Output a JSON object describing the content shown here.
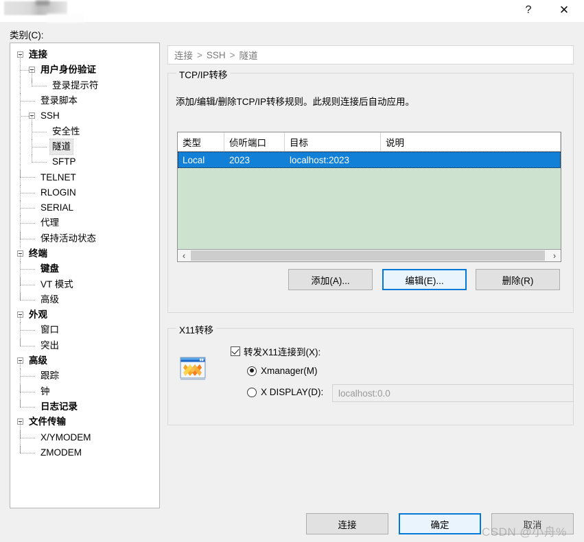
{
  "window": {
    "title_redacted": "",
    "help_icon": "question-mark-icon",
    "close_icon": "close-icon"
  },
  "category": {
    "label": "类别(C):",
    "tree": [
      {
        "label": "连接",
        "level": 0,
        "bold": true,
        "expander": true,
        "selected": false
      },
      {
        "label": "用户身份验证",
        "level": 1,
        "bold": true,
        "expander": true,
        "selected": false
      },
      {
        "label": "登录提示符",
        "level": 2,
        "bold": false,
        "expander": false,
        "selected": false
      },
      {
        "label": "登录脚本",
        "level": 1,
        "bold": false,
        "expander": false,
        "selected": false
      },
      {
        "label": "SSH",
        "level": 1,
        "bold": false,
        "expander": true,
        "selected": false
      },
      {
        "label": "安全性",
        "level": 2,
        "bold": false,
        "expander": false,
        "selected": false
      },
      {
        "label": "隧道",
        "level": 2,
        "bold": false,
        "expander": false,
        "selected": true
      },
      {
        "label": "SFTP",
        "level": 2,
        "bold": false,
        "expander": false,
        "selected": false
      },
      {
        "label": "TELNET",
        "level": 1,
        "bold": false,
        "expander": false,
        "selected": false
      },
      {
        "label": "RLOGIN",
        "level": 1,
        "bold": false,
        "expander": false,
        "selected": false
      },
      {
        "label": "SERIAL",
        "level": 1,
        "bold": false,
        "expander": false,
        "selected": false
      },
      {
        "label": "代理",
        "level": 1,
        "bold": false,
        "expander": false,
        "selected": false
      },
      {
        "label": "保持活动状态",
        "level": 1,
        "bold": false,
        "expander": false,
        "selected": false
      },
      {
        "label": "终端",
        "level": 0,
        "bold": true,
        "expander": true,
        "selected": false
      },
      {
        "label": "键盘",
        "level": 1,
        "bold": true,
        "expander": false,
        "selected": false
      },
      {
        "label": "VT 模式",
        "level": 1,
        "bold": false,
        "expander": false,
        "selected": false
      },
      {
        "label": "高级",
        "level": 1,
        "bold": false,
        "expander": false,
        "selected": false
      },
      {
        "label": "外观",
        "level": 0,
        "bold": true,
        "expander": true,
        "selected": false
      },
      {
        "label": "窗口",
        "level": 1,
        "bold": false,
        "expander": false,
        "selected": false
      },
      {
        "label": "突出",
        "level": 1,
        "bold": false,
        "expander": false,
        "selected": false
      },
      {
        "label": "高级",
        "level": 0,
        "bold": true,
        "expander": true,
        "selected": false
      },
      {
        "label": "跟踪",
        "level": 1,
        "bold": false,
        "expander": false,
        "selected": false
      },
      {
        "label": "钟",
        "level": 1,
        "bold": false,
        "expander": false,
        "selected": false
      },
      {
        "label": "日志记录",
        "level": 1,
        "bold": true,
        "expander": false,
        "selected": false
      },
      {
        "label": "文件传输",
        "level": 0,
        "bold": true,
        "expander": true,
        "selected": false
      },
      {
        "label": "X/YMODEM",
        "level": 1,
        "bold": false,
        "expander": false,
        "selected": false
      },
      {
        "label": "ZMODEM",
        "level": 1,
        "bold": false,
        "expander": false,
        "selected": false
      }
    ]
  },
  "breadcrumb": {
    "part1": "连接",
    "part2": "SSH",
    "part3": "隧道",
    "separator": ">"
  },
  "tcpip": {
    "group_title": "TCP/IP转移",
    "description": "添加/编辑/删除TCP/IP转移规则。此规则连接后自动应用。",
    "columns": [
      "类型",
      "侦听端口",
      "目标",
      "说明"
    ],
    "rows": [
      {
        "type": "Local",
        "port": "2023",
        "target": "localhost:2023",
        "desc": ""
      }
    ],
    "buttons": {
      "add": "添加(A)...",
      "edit": "编辑(E)...",
      "delete": "删除(R)"
    },
    "scroll_left_icon": "chevron-left-icon",
    "scroll_right_icon": "chevron-right-icon"
  },
  "x11": {
    "group_title": "X11转移",
    "icon_name": "xmanager-icon",
    "forward_checkbox_label": "转发X11连接到(X):",
    "forward_checked": true,
    "radio_xmanager_label": "Xmanager(M)",
    "radio_xdisplay_label": "X DISPLAY(D):",
    "selected_radio": "xmanager",
    "display_value": "localhost:0.0"
  },
  "footer": {
    "connect": "连接",
    "ok": "确定",
    "cancel": "取消"
  },
  "watermark": {
    "text": "CSDN @小舟%"
  },
  "colors": {
    "accent": "#0078d7",
    "selection_blue": "#1280d6",
    "list_background": "#cde3cf",
    "dialog_background": "#f0f0f0"
  }
}
